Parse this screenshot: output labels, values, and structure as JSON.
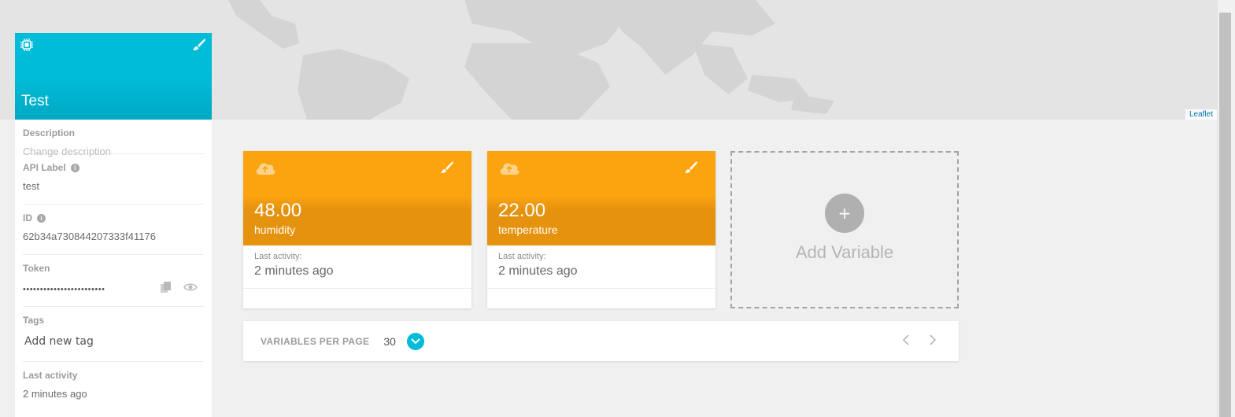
{
  "map": {
    "attribution": "Leaflet"
  },
  "device": {
    "name": "Test",
    "fields": {
      "description_label": "Description",
      "description_placeholder": "Change description",
      "api_label_label": "API Label",
      "api_label_value": "test",
      "id_label": "ID",
      "id_value": "62b34a730844207333f41176",
      "token_label": "Token",
      "token_value": "••••••••••••••••••••••••",
      "tags_label": "Tags",
      "tags_input": "Add new tag",
      "last_activity_label": "Last activity",
      "last_activity_value": "2 minutes ago"
    }
  },
  "variables": [
    {
      "value": "48.00",
      "name": "humidity",
      "activity_label": "Last activity:",
      "activity_value": "2 minutes ago"
    },
    {
      "value": "22.00",
      "name": "temperature",
      "activity_label": "Last activity:",
      "activity_value": "2 minutes ago"
    }
  ],
  "add_variable": {
    "icon": "+",
    "label": "Add Variable"
  },
  "pager": {
    "label": "VARIABLES PER PAGE",
    "count": "30"
  },
  "colors": {
    "device_header": "#00bcd8",
    "variable_card": "#fba410",
    "accent": "#00bcd8"
  }
}
